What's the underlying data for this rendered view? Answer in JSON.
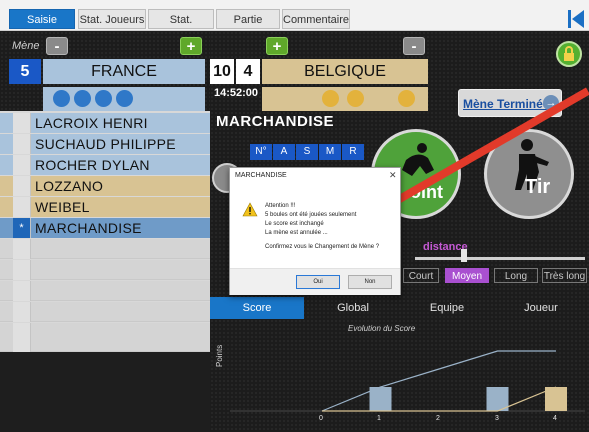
{
  "tabs": [
    {
      "label": "Saisie",
      "active": true
    },
    {
      "label": "Stat. Joueurs",
      "active": false
    },
    {
      "label": "Stat. Equipes",
      "active": false
    },
    {
      "label": "Partie",
      "active": false
    },
    {
      "label": "Commentaire",
      "active": false
    }
  ],
  "header": {
    "mene_label": "Mène",
    "mene_number": "5",
    "minus_label": "-",
    "plus_label": "+",
    "team_left": "FRANCE",
    "team_right": "BELGIQUE",
    "score_left": "10",
    "score_right": "4",
    "time": "14:52:00",
    "boules_left": 4,
    "boules_right": 3
  },
  "players": [
    {
      "name": "LACROIX HENRI",
      "team": "fr",
      "mark": ""
    },
    {
      "name": "SUCHAUD PHILIPPE",
      "team": "fr",
      "mark": ""
    },
    {
      "name": "ROCHER DYLAN",
      "team": "fr",
      "mark": ""
    },
    {
      "name": "LOZZANO",
      "team": "be",
      "mark": ""
    },
    {
      "name": "WEIBEL",
      "team": "be",
      "mark": ""
    },
    {
      "name": "MARCHANDISE",
      "team": "sel",
      "mark": "*"
    }
  ],
  "main": {
    "active_player": "MARCHANDISE",
    "mene_terminee": "Mène Terminée",
    "stat_columns": [
      "N°",
      "A",
      "S",
      "M",
      "R"
    ],
    "point_label": "oint",
    "tir_label": "Tir",
    "distance_label": "distance",
    "distance_options": [
      {
        "label": "Court",
        "selected": false
      },
      {
        "label": "Moyen",
        "selected": true
      },
      {
        "label": "Long",
        "selected": false
      },
      {
        "label": "Très long",
        "selected": false
      }
    ]
  },
  "subtabs": [
    {
      "label": "Score",
      "active": true
    },
    {
      "label": "Global",
      "active": false
    },
    {
      "label": "Equipe",
      "active": false
    },
    {
      "label": "Joueur",
      "active": false
    }
  ],
  "colors": {
    "france": "#a9c3dc",
    "belgique": "#d8c393",
    "accent_blue": "#1976c8",
    "boule_blue": "#2f78c8",
    "boule_gold": "#e3b23c",
    "arrow_red": "#e23a2a"
  },
  "dialog": {
    "title": "MARCHANDISE",
    "close": "✕",
    "lines": [
      "Attention !!!",
      "5 boules ont été jouées seulement",
      "Le score est inchangé",
      "La mène est annulée ...",
      "",
      "Confirmez vous le Changement de Mène ?"
    ],
    "yes_label": "Oui",
    "no_label": "Non"
  },
  "chart_data": {
    "type": "bar",
    "title": "Evolution du Score",
    "ylabel": "Points",
    "categories": [
      "0",
      "1",
      "2",
      "3",
      "4"
    ],
    "series": [
      {
        "values": [
          0,
          4,
          0,
          4,
          0
        ],
        "color": "#9ab2c8"
      },
      {
        "values": [
          0,
          0,
          0,
          0,
          4
        ],
        "color": "#d8c393"
      }
    ],
    "lines": [
      {
        "values": [
          0,
          4,
          7,
          10,
          10
        ],
        "color": "#9ab2c8"
      },
      {
        "values": [
          0,
          0,
          0,
          0,
          4
        ],
        "color": "#d8c393"
      }
    ]
  }
}
